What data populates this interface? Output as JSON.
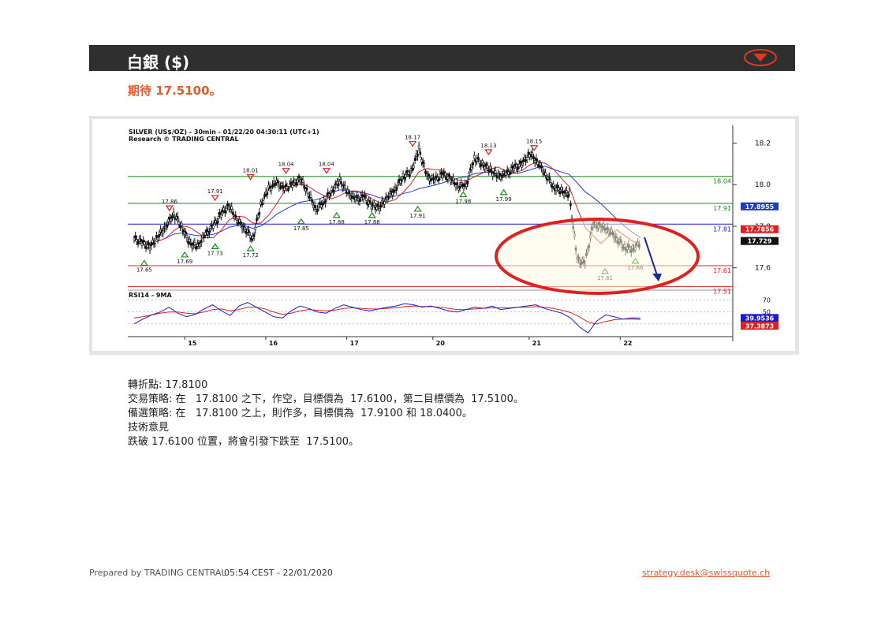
{
  "header": {
    "title": "白銀 ($)",
    "accent_color": "#e03a1e",
    "menu_icon": "triangle-down-circle-icon"
  },
  "subtitle": "期待 17.5100。",
  "chart_data": {
    "type": "candlestick",
    "title": "SILVER (US$/OZ) - 30min - 01/22/20 04:30:11 (UTC+1)",
    "subtitle": "Research © TRADING CENTRAL",
    "price_axis": {
      "ylim": [
        17.5,
        18.24
      ],
      "ticks": [
        18.2,
        18.0,
        17.8,
        17.6
      ],
      "tick_labels": [
        "18.2",
        "18.0",
        "17.8",
        "17.6"
      ]
    },
    "x_ticks": [
      "15",
      "16",
      "17",
      "20",
      "21",
      "22"
    ],
    "horizontal_levels": [
      {
        "value": 18.04,
        "label": "18.04",
        "color": "#1a8c1a"
      },
      {
        "value": 17.91,
        "label": "17.91",
        "color": "#1a8c1a"
      },
      {
        "value": 17.81,
        "label": "17.81",
        "color": "#1a1ad0"
      },
      {
        "value": 17.61,
        "label": "17.61",
        "color": "#e02020"
      },
      {
        "value": 17.51,
        "label": "17.51",
        "color": "#e02020"
      }
    ],
    "value_tags": [
      {
        "value": 17.8955,
        "label": "17.8955",
        "color": "#1a3cc8"
      },
      {
        "value": 17.7856,
        "label": "17.7856",
        "color": "#e02020"
      },
      {
        "value": 17.729,
        "label": "17.729",
        "color": "#111111"
      }
    ],
    "swing_labels": [
      {
        "text": "17.65",
        "value": 17.65,
        "kind": "low"
      },
      {
        "text": "17.86",
        "value": 17.86,
        "kind": "high"
      },
      {
        "text": "17.69",
        "value": 17.69,
        "kind": "low"
      },
      {
        "text": "17.91",
        "value": 17.91,
        "kind": "high"
      },
      {
        "text": "17.73",
        "value": 17.73,
        "kind": "low"
      },
      {
        "text": "18.01",
        "value": 18.01,
        "kind": "high"
      },
      {
        "text": "17.72",
        "value": 17.72,
        "kind": "low"
      },
      {
        "text": "18.04",
        "value": 18.04,
        "kind": "high"
      },
      {
        "text": "17.85",
        "value": 17.85,
        "kind": "low"
      },
      {
        "text": "18.04",
        "value": 18.04,
        "kind": "high"
      },
      {
        "text": "17.88",
        "value": 17.88,
        "kind": "low"
      },
      {
        "text": "17.88",
        "value": 17.88,
        "kind": "low"
      },
      {
        "text": "18.17",
        "value": 18.17,
        "kind": "high"
      },
      {
        "text": "17.91",
        "value": 17.91,
        "kind": "low"
      },
      {
        "text": "17.98",
        "value": 17.98,
        "kind": "low"
      },
      {
        "text": "18.13",
        "value": 18.13,
        "kind": "high"
      },
      {
        "text": "17.99",
        "value": 17.99,
        "kind": "low"
      },
      {
        "text": "18.15",
        "value": 18.15,
        "kind": "high"
      },
      {
        "text": "17.61",
        "value": 17.61,
        "kind": "low"
      },
      {
        "text": "17.66",
        "value": 17.66,
        "kind": "low"
      }
    ],
    "price_path": [
      17.74,
      17.72,
      17.7,
      17.75,
      17.8,
      17.86,
      17.8,
      17.72,
      17.7,
      17.76,
      17.8,
      17.86,
      17.9,
      17.83,
      17.79,
      17.74,
      17.9,
      17.98,
      18.01,
      17.98,
      18.0,
      18.03,
      17.96,
      17.88,
      17.92,
      17.97,
      18.02,
      17.96,
      17.93,
      17.94,
      17.9,
      17.89,
      17.94,
      17.98,
      18.04,
      18.06,
      18.17,
      18.04,
      18.02,
      18.05,
      18.03,
      17.99,
      18.0,
      18.13,
      18.1,
      18.07,
      18.04,
      18.05,
      18.08,
      18.1,
      18.15,
      18.11,
      18.05,
      17.99,
      17.97,
      17.95,
      17.64,
      17.62,
      17.81,
      17.8,
      17.78,
      17.74,
      17.7,
      17.69,
      17.72
    ],
    "rsi_panel": {
      "label": "RSI14 - 9MA",
      "ticks": [
        "70",
        "50",
        "30"
      ],
      "rsi_value": "39.9536",
      "ma_value": "37.3873",
      "rsi_color": "#1a1ad0",
      "ma_color": "#e02020",
      "rsi_path": [
        30,
        38,
        45,
        50,
        58,
        48,
        42,
        46,
        55,
        62,
        52,
        44,
        60,
        66,
        58,
        50,
        42,
        40,
        52,
        60,
        56,
        50,
        48,
        56,
        62,
        58,
        54,
        52,
        55,
        58,
        60,
        64,
        62,
        58,
        60,
        56,
        52,
        50,
        54,
        58,
        56,
        60,
        54,
        56,
        58,
        60,
        62,
        56,
        52,
        48,
        40,
        25,
        15,
        35,
        45,
        42,
        38,
        40,
        39.95
      ],
      "ma_path": [
        40,
        42,
        45,
        48,
        50,
        50,
        48,
        47,
        50,
        54,
        55,
        52,
        54,
        58,
        58,
        55,
        50,
        46,
        48,
        52,
        54,
        53,
        52,
        53,
        56,
        57,
        56,
        55,
        55,
        56,
        57,
        59,
        60,
        59,
        59,
        58,
        56,
        54,
        54,
        55,
        56,
        57,
        57,
        57,
        58,
        58,
        59,
        58,
        56,
        53,
        49,
        42,
        33,
        30,
        34,
        37,
        38,
        38,
        37.39
      ]
    },
    "annotation": {
      "type": "ellipse-highlight",
      "arrow": "down",
      "color": "#e02020"
    }
  },
  "notes": {
    "pivot": "轉折點: 17.8100",
    "strategy": "交易策略: 在   17.8100 之下，作空，目標價為  17.6100，第二目標價為  17.5100。",
    "alternative": "備選策略: 在   17.8100 之上，則作多，目標價為  17.9100 和 18.0400。",
    "comment_title": "技術意見",
    "comment": "跌破 17.6100 位置，將會引發下跌至  17.5100。"
  },
  "footer": {
    "prepared_by": "Prepared by TRADING CENTRAL",
    "timestamp": "05:54 CEST - 22/01/2020",
    "email": "strategy.desk@swissquote.ch"
  }
}
